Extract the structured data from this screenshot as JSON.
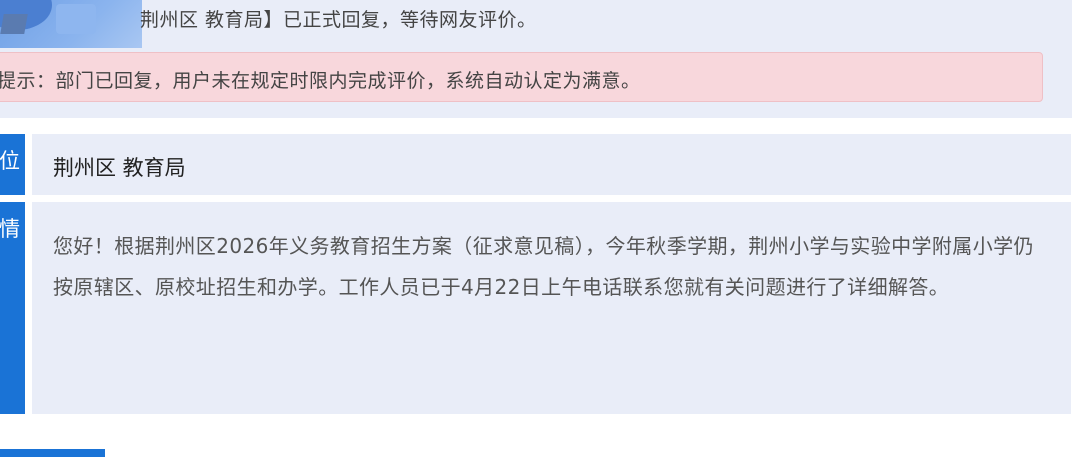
{
  "status": {
    "message": "荆州区 教育局】已正式回复，等待网友评价。"
  },
  "notice": {
    "text": "提示：部门已回复，用户未在规定时限内完成评价，系统自动认定为满意。"
  },
  "reply_unit": {
    "label": "位",
    "value": "荆州区 教育局"
  },
  "reply_content": {
    "label": "情",
    "text": "您好！根据荆州区2026年义务教育招生方案（征求意见稿），今年秋季学期，荆州小学与实验中学附属小学仍按原辖区、原校址招生和办学。工作人员已于4月22日上午电话联系您就有关问题进行了详细解答。"
  },
  "colors": {
    "accent": "#1a73d6",
    "panel_bg": "#e9edf8",
    "notice_bg": "#f8d7dc"
  }
}
